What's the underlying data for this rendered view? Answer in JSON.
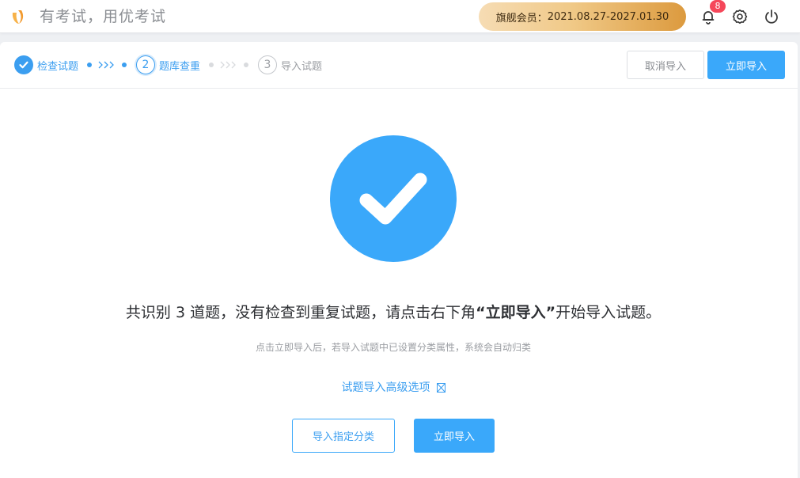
{
  "header": {
    "slogan": "有考试，用优考试",
    "member_label": "旗舰会员：",
    "member_period": "2021.08.27-2027.01.30",
    "notification_count": "8",
    "icons": [
      "logo-icon",
      "bell-icon",
      "gear-icon",
      "power-icon"
    ]
  },
  "steps": [
    {
      "number": "1",
      "label": "检查试题",
      "state": "done"
    },
    {
      "number": "2",
      "label": "题库查重",
      "state": "active"
    },
    {
      "number": "3",
      "label": "导入试题",
      "state": "todo"
    }
  ],
  "actions": {
    "cancel_label": "取消导入",
    "import_label": "立即导入"
  },
  "result": {
    "message_prefix": "共识别 3 道题，没有检查到重复试题，请点击右下角",
    "message_highlight": "“立即导入”",
    "message_suffix": "开始导入试题。",
    "hint": "点击立即导入后，若导入试题中已设置分类属性，系统会自动归类",
    "advanced_label": "试题导入高级选项",
    "assign_category_label": "导入指定分类",
    "import_now_label": "立即导入"
  },
  "colors": {
    "accent": "#3aa8fa",
    "step_active": "#3b9ef0",
    "badge": "#f5475a",
    "member_gold": "#f0c987"
  }
}
